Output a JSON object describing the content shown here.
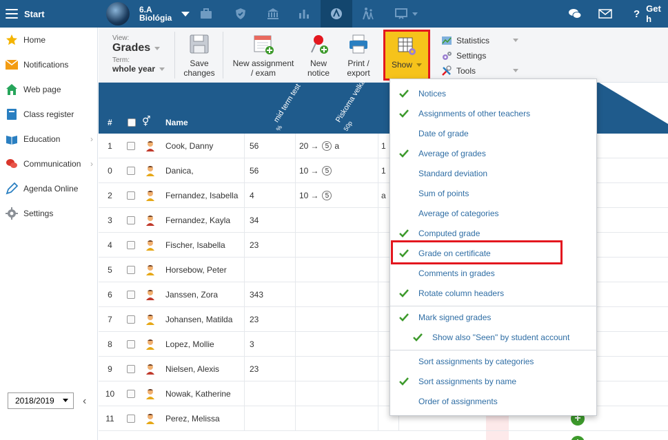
{
  "topbar": {
    "start_label": "Start",
    "class_name": "6.A",
    "class_subject": "Biológia",
    "help_label": "Get h"
  },
  "sidebar": {
    "items": [
      {
        "label": "Home",
        "icon": "star-icon"
      },
      {
        "label": "Notifications",
        "icon": "envelope-icon"
      },
      {
        "label": "Web page",
        "icon": "house-icon"
      },
      {
        "label": "Class register",
        "icon": "book-icon"
      },
      {
        "label": "Education",
        "icon": "open-book-icon"
      },
      {
        "label": "Communication",
        "icon": "chat-icon"
      },
      {
        "label": "Agenda Online",
        "icon": "pen-icon"
      },
      {
        "label": "Settings",
        "icon": "gear-icon"
      }
    ],
    "school_year": "2018/2019"
  },
  "toolbar": {
    "view_label": "View:",
    "view_value": "Grades",
    "term_label": "Term:",
    "term_value": "whole year",
    "save_line1": "Save",
    "save_line2": "changes",
    "new_assign_line1": "New assignment",
    "new_assign_line2": "/ exam",
    "new_notice_line1": "New",
    "new_notice_line2": "notice",
    "print_line1": "Print /",
    "print_line2": "export",
    "show_label": "Show",
    "statistics_label": "Statistics",
    "settings_label": "Settings",
    "tools_label": "Tools"
  },
  "table": {
    "col_num": "#",
    "col_name": "Name",
    "col1_title": "mid term test",
    "col1_sub": "%",
    "col2_title": "Piskoma velka",
    "col2_sub": "50p",
    "rows": [
      {
        "num": "1",
        "name": "Cook, Danny",
        "c1": "56",
        "c2a": "20",
        "c2b": "5",
        "c2c": "a",
        "c3": "1"
      },
      {
        "num": "0",
        "name": "Danica,",
        "c1": "56",
        "c2a": "10",
        "c2b": "5",
        "c2c": "",
        "c3": "1"
      },
      {
        "num": "2",
        "name": "Fernandez, Isabella",
        "c1": "4",
        "c2a": "10",
        "c2b": "5",
        "c2c": "",
        "c3": "a"
      },
      {
        "num": "3",
        "name": "Fernandez, Kayla",
        "c1": "34",
        "c2a": "",
        "c2b": "",
        "c2c": "",
        "c3": ""
      },
      {
        "num": "4",
        "name": "Fischer, Isabella",
        "c1": "23",
        "c2a": "",
        "c2b": "",
        "c2c": "",
        "c3": ""
      },
      {
        "num": "5",
        "name": "Horsebow, Peter",
        "c1": "",
        "c2a": "",
        "c2b": "",
        "c2c": "",
        "c3": ""
      },
      {
        "num": "6",
        "name": "Janssen, Zora",
        "c1": "343",
        "c2a": "",
        "c2b": "",
        "c2c": "",
        "c3": ""
      },
      {
        "num": "7",
        "name": "Johansen, Matilda",
        "c1": "23",
        "c2a": "",
        "c2b": "",
        "c2c": "",
        "c3": ""
      },
      {
        "num": "8",
        "name": "Lopez, Mollie",
        "c1": "3",
        "c2a": "",
        "c2b": "",
        "c2c": "",
        "c3": ""
      },
      {
        "num": "9",
        "name": "Nielsen, Alexis",
        "c1": "23",
        "c2a": "",
        "c2b": "",
        "c2c": "",
        "c3": ""
      },
      {
        "num": "10",
        "name": "Nowak, Katherine",
        "c1": "",
        "c2a": "",
        "c2b": "",
        "c2c": "",
        "c3": ""
      },
      {
        "num": "11",
        "name": "Perez, Melissa",
        "c1": "",
        "c2a": "",
        "c2b": "",
        "c2c": "",
        "c3": ""
      }
    ]
  },
  "show_menu": {
    "items": [
      {
        "label": "Notices",
        "checked": true
      },
      {
        "label": "Assignments of other teachers",
        "checked": true
      },
      {
        "label": "Date of grade",
        "checked": false
      },
      {
        "label": "Average of grades",
        "checked": true
      },
      {
        "label": "Standard deviation",
        "checked": false
      },
      {
        "label": "Sum of points",
        "checked": false
      },
      {
        "label": "Average of categories",
        "checked": false
      },
      {
        "label": "Computed grade",
        "checked": true
      },
      {
        "label": "Grade on certificate",
        "checked": true
      },
      {
        "label": "Comments in grades",
        "checked": false
      },
      {
        "label": "Rotate column headers",
        "checked": true
      },
      {
        "label": "Mark signed grades",
        "checked": true
      },
      {
        "label": "Show also \"Seen\" by student account",
        "checked": true
      },
      {
        "label": "Sort assignments by categories",
        "checked": false
      },
      {
        "label": "Sort assignments by name",
        "checked": true
      },
      {
        "label": "Order of assignments",
        "checked": false
      }
    ]
  },
  "colors": {
    "brand": "#1f5b8c",
    "accent": "#f6c31b",
    "highlight": "#e3171f",
    "check": "#3d9a2c",
    "link": "#2e6da4"
  }
}
